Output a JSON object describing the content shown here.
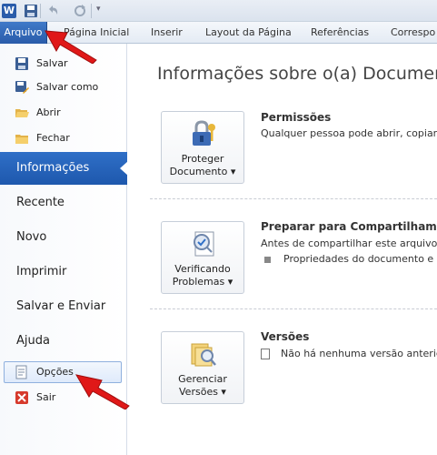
{
  "qat": {
    "app_logo": "W"
  },
  "tabs": [
    {
      "label": "Arquivo"
    },
    {
      "label": "Página Inicial"
    },
    {
      "label": "Inserir"
    },
    {
      "label": "Layout da Página"
    },
    {
      "label": "Referências"
    },
    {
      "label": "Correspo"
    }
  ],
  "nav": {
    "small_items": [
      {
        "label": "Salvar",
        "icon": "save-icon"
      },
      {
        "label": "Salvar como",
        "icon": "save-as-icon"
      },
      {
        "label": "Abrir",
        "icon": "open-folder-icon"
      },
      {
        "label": "Fechar",
        "icon": "close-folder-icon"
      }
    ],
    "big_items": [
      {
        "label": "Informações",
        "active": true
      },
      {
        "label": "Recente"
      },
      {
        "label": "Novo"
      },
      {
        "label": "Imprimir"
      },
      {
        "label": "Salvar e Enviar"
      },
      {
        "label": "Ajuda"
      }
    ],
    "opcoes": {
      "label": "Opções",
      "icon": "options-icon"
    },
    "sair": {
      "label": "Sair",
      "icon": "exit-icon"
    }
  },
  "main": {
    "title": "Informações sobre o(a) Documen",
    "sections": [
      {
        "button_line1": "Proteger",
        "button_line2": "Documento ▾",
        "heading": "Permissões",
        "text": "Qualquer pessoa pode abrir, copiar e"
      },
      {
        "button_line1": "Verificando",
        "button_line2": "Problemas ▾",
        "heading": "Preparar para Compartilhament",
        "text": "Antes de compartilhar este arquivo, s",
        "bullet": "Propriedades do documento e n"
      },
      {
        "button_line1": "Gerenciar",
        "button_line2": "Versões ▾",
        "heading": "Versões",
        "bullet": "Não há nenhuma versão anteric"
      }
    ]
  },
  "colors": {
    "accent": "#2a5caa",
    "active_nav": "#1e58ad",
    "arrow": "#e01818"
  }
}
